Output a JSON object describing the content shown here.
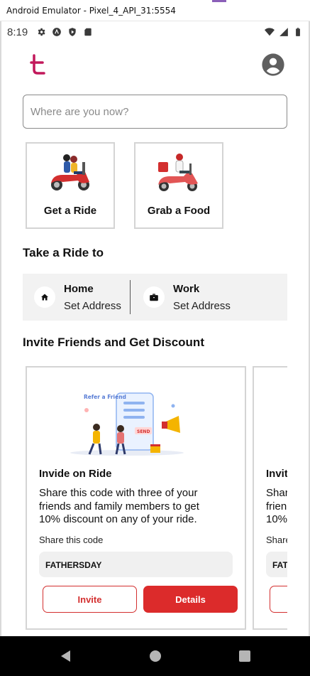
{
  "window": {
    "title": "Android Emulator - Pixel_4_API_31:5554"
  },
  "status_bar": {
    "time": "8:19",
    "left_icons": [
      "gear-icon",
      "android-icon",
      "play-protect-icon",
      "sd-card-icon"
    ],
    "right_icons": [
      "wifi-icon",
      "signal-icon",
      "battery-icon"
    ]
  },
  "header": {
    "logo_icon": "brand-t-logo",
    "profile_icon": "account-circle-icon"
  },
  "search": {
    "placeholder": "Where are you now?",
    "value": ""
  },
  "services": [
    {
      "label": "Get a Ride",
      "icon": "scooter-riders-illustration"
    },
    {
      "label": "Grab a Food",
      "icon": "delivery-scooter-illustration"
    }
  ],
  "take_ride": {
    "title": "Take a Ride to",
    "places": [
      {
        "name": "Home",
        "sub": "Set Address",
        "icon": "home-icon"
      },
      {
        "name": "Work",
        "sub": "Set Address",
        "icon": "briefcase-icon"
      }
    ]
  },
  "invite": {
    "title": "Invite Friends and Get Discount",
    "cards": [
      {
        "art_text": "Refer a Friend",
        "art_send": "SEND",
        "title": "Invide on Ride",
        "description": [
          "Share this code with three of your",
          "friends and family members to get",
          "10% discount on any of your ride."
        ],
        "share_label": "Share this code",
        "code": "FATHERSDAY",
        "invite_label": "Invite",
        "details_label": "Details"
      },
      {
        "title": "Invit",
        "description": [
          "Shar",
          "frien",
          "10%"
        ],
        "share_label": "Share",
        "code": "FAT"
      }
    ]
  },
  "colors": {
    "brand": "#c2185b",
    "accent_red": "#dc2b2b",
    "text": "#111111",
    "address_bg": "#f2f2f2"
  },
  "nav": {
    "back_icon": "back-triangle-icon",
    "home_icon": "home-circle-icon",
    "recent_icon": "recents-square-icon"
  }
}
